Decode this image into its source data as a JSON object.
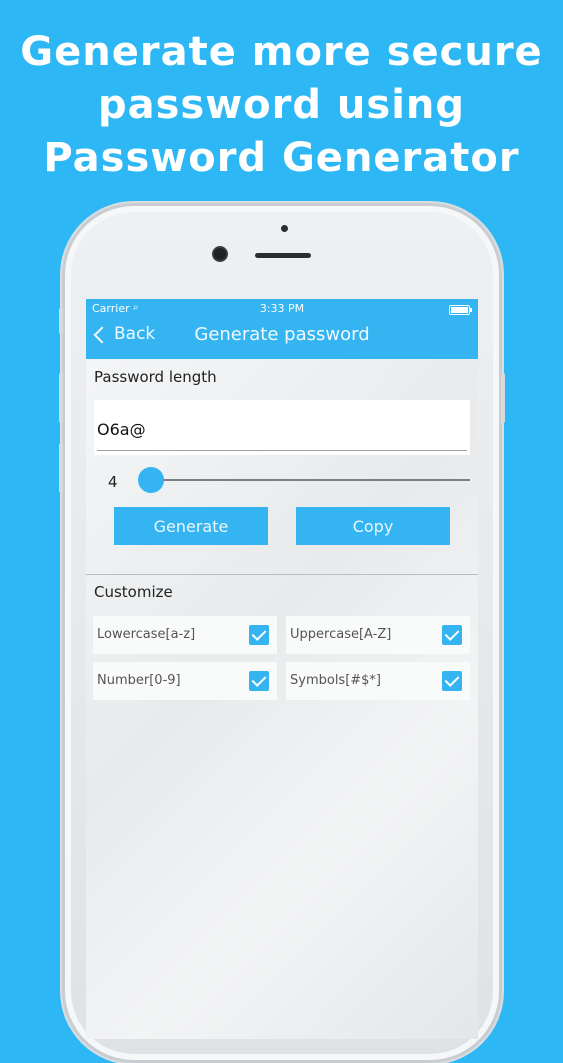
{
  "headline": {
    "line1": "Generate more secure",
    "line2": "password using",
    "line3": "Password Generator"
  },
  "status_bar": {
    "carrier": "Carrier",
    "time": "3:33 PM"
  },
  "nav": {
    "back_label": "Back",
    "title": "Generate password"
  },
  "password_length": {
    "label": "Password length",
    "value": "4",
    "slider_min_fraction": 0.0
  },
  "password_field": {
    "value": "O6a@"
  },
  "actions": {
    "generate_label": "Generate",
    "copy_label": "Copy"
  },
  "customize": {
    "label": "Customize",
    "options": [
      {
        "label": "Lowercase[a-z]",
        "checked": true
      },
      {
        "label": "Uppercase[A-Z]",
        "checked": true
      },
      {
        "label": "Number[0-9]",
        "checked": true
      },
      {
        "label": "Symbols[#$*]",
        "checked": true
      }
    ]
  },
  "colors": {
    "background": "#2db8f5",
    "accent": "#34b4f0"
  }
}
